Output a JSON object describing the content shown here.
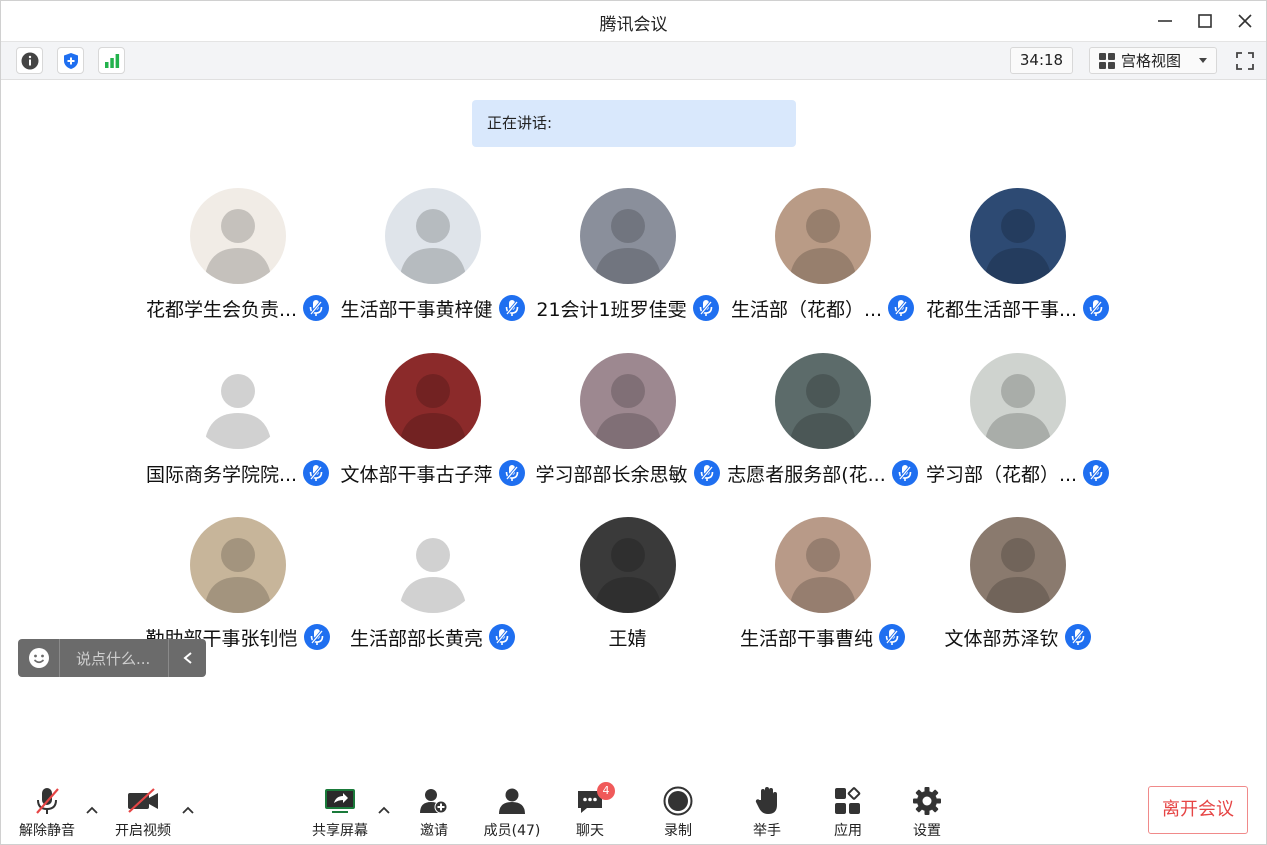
{
  "window": {
    "title": "腾讯会议"
  },
  "toolbar": {
    "timer": "34:18",
    "view_label": "宫格视图"
  },
  "speaking_label": "正在讲话:",
  "participants": [
    {
      "name": "花都学生会负责...",
      "mic": true,
      "avatar_color": "#f1ece6"
    },
    {
      "name": "生活部干事黄梓健",
      "mic": true,
      "avatar_color": "#dfe4ea"
    },
    {
      "name": "21会计1班罗佳雯",
      "mic": true,
      "avatar_color": "#8a8f9b"
    },
    {
      "name": "生活部（花都）...",
      "mic": true,
      "avatar_color": "#b99b86"
    },
    {
      "name": "花都生活部干事...",
      "mic": true,
      "avatar_color": "#2d4a73"
    },
    {
      "name": "国际商务学院院...",
      "mic": true,
      "avatar_color": "#ffffff"
    },
    {
      "name": "文体部干事古子萍",
      "mic": true,
      "avatar_color": "#8b2a2a"
    },
    {
      "name": "学习部部长余思敏",
      "mic": true,
      "avatar_color": "#9d8890"
    },
    {
      "name": "志愿者服务部(花...",
      "mic": true,
      "avatar_color": "#5c6b6a"
    },
    {
      "name": "学习部（花都）...",
      "mic": true,
      "avatar_color": "#cfd3cf"
    },
    {
      "name": "勤助部干事张钊恺",
      "mic": true,
      "avatar_color": "#c7b59a"
    },
    {
      "name": "生活部部长黄亮",
      "mic": true,
      "avatar_color": "#ffffff"
    },
    {
      "name": "王婧",
      "mic": false,
      "avatar_color": "#3a3a3a"
    },
    {
      "name": "生活部干事曹纯",
      "mic": true,
      "avatar_color": "#b89a88"
    },
    {
      "name": "文体部苏泽钦",
      "mic": true,
      "avatar_color": "#8a7a6e"
    }
  ],
  "chat_placeholder": "说点什么...",
  "bottom_bar": {
    "unmute": "解除静音",
    "start_video": "开启视频",
    "share_screen": "共享屏幕",
    "invite": "邀请",
    "members": "成员(47)",
    "chat": "聊天",
    "chat_badge": "4",
    "record": "录制",
    "raise_hand": "举手",
    "apps": "应用",
    "settings": "设置",
    "leave": "离开会议"
  },
  "colors": {
    "accent": "#1f6ff0",
    "speaking_bg": "#d9e8fc",
    "leave": "#e64545",
    "signal": "#22b24c"
  }
}
